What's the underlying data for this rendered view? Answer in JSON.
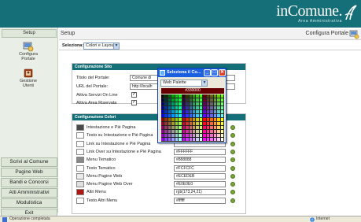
{
  "header": {
    "brand": "inComune.",
    "brand_sub": "Area Amministrativa"
  },
  "sidebar": {
    "tab": "Setup",
    "items": [
      {
        "label": "Configura\nPortale"
      },
      {
        "label": "Gestione\nUtenti"
      }
    ],
    "nav": [
      "Scrivi al Comune",
      "Pagine Web",
      "Bandi e Concorsi",
      "Atti Amministrativi",
      "Modulistica",
      "Exit"
    ]
  },
  "main": {
    "title": "Setup",
    "right_title": "Configura Portale",
    "toolbar_label": "Seleziona:",
    "toolbar_select": "Colori e Layout"
  },
  "site_config": {
    "heading": "Configurazione Sito",
    "rows": [
      {
        "label": "Titolo del Portale:",
        "value": "Comune di"
      },
      {
        "label": "URL del Portale:",
        "value": "http://localh"
      },
      {
        "label": "Attiva Servizi On Line",
        "checked": "✓"
      },
      {
        "label": "Attiva Area Riservata",
        "checked": "✓"
      }
    ]
  },
  "colors_config": {
    "heading": "Configurazione Colori",
    "rows": [
      {
        "label": "Intestazione e Piè Pagina",
        "value": "",
        "color": "#4a4a4a"
      },
      {
        "label": "Testo su Intestazione e Piè Pagina",
        "value": "",
        "color": "#ffffff"
      },
      {
        "label": "Link su Intestazione e Piè Pagina",
        "value": "",
        "color": "#ffffff"
      },
      {
        "label": "Link Over su Intestazione e Piè Pagina",
        "value": "#FFFFFF",
        "color": "#ffffff"
      },
      {
        "label": "Menu Tematico",
        "value": "#888888",
        "color": "#888888"
      },
      {
        "label": "Testo Tematico",
        "value": "#FCFCFC",
        "color": "#fcfcfc"
      },
      {
        "label": "Menu Pagine Web",
        "value": "#ECEDEB",
        "color": "#ecedeb"
      },
      {
        "label": "Menu Pagine Web Over",
        "value": "#E0E0E0",
        "color": "#e0e0e0"
      },
      {
        "label": "Altri Menu",
        "value": "rgb(173,24,21)",
        "color": "#ad1815"
      },
      {
        "label": "Testo Altri Menu",
        "value": "#ffffff",
        "color": "#ffffff"
      }
    ]
  },
  "picker": {
    "title": "Seleziona il Co...",
    "select": "Web Palette",
    "hex": "#330000"
  },
  "statusbar": {
    "left": "Operazione completata",
    "right": "Internet"
  },
  "colors": {
    "banner": "#156f78",
    "accent": "#156f78"
  }
}
